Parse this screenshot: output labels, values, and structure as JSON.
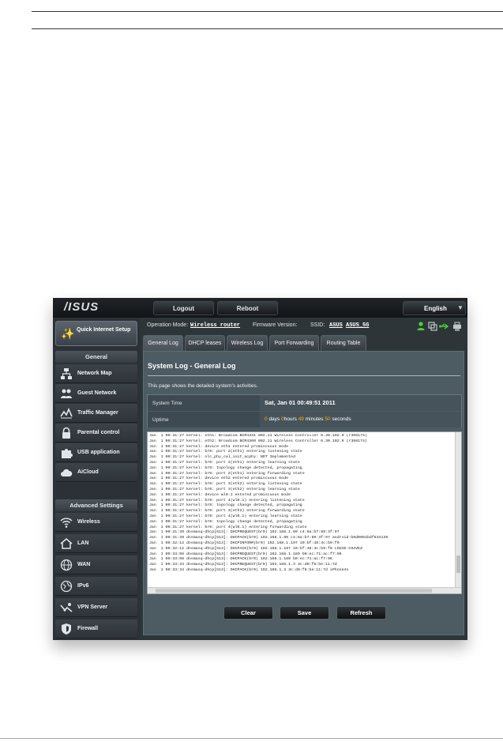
{
  "brand": {
    "logo_text": "/ISUS"
  },
  "topbar": {
    "logout_label": "Logout",
    "reboot_label": "Reboot",
    "language": "English"
  },
  "status": {
    "operation_mode_label": "Operation Mode:",
    "operation_mode_value": "Wireless router",
    "firmware_label": "Firmware Version:",
    "ssid_label": "SSID:",
    "ssid_1": "ASUS",
    "ssid_2": "ASUS_5G",
    "icons": [
      "user-icon",
      "copy-icon",
      "usb-icon",
      "printer-icon"
    ],
    "icon_color": "#4cd137"
  },
  "sidebar": {
    "quick_setup_label": "Quick Internet Setup",
    "general_header": "General",
    "general_items": [
      {
        "label": "Network Map",
        "icon": "network-map-icon"
      },
      {
        "label": "Guest Network",
        "icon": "guest-network-icon"
      },
      {
        "label": "Traffic Manager",
        "icon": "traffic-manager-icon"
      },
      {
        "label": "Parental control",
        "icon": "parental-control-icon"
      },
      {
        "label": "USB application",
        "icon": "usb-application-icon"
      },
      {
        "label": "AiCloud",
        "icon": "aicloud-icon"
      }
    ],
    "advanced_header": "Advanced Settings",
    "advanced_items": [
      {
        "label": "Wireless",
        "icon": "wireless-icon"
      },
      {
        "label": "LAN",
        "icon": "lan-icon"
      },
      {
        "label": "WAN",
        "icon": "wan-icon"
      },
      {
        "label": "IPv6",
        "icon": "ipv6-icon"
      },
      {
        "label": "VPN Server",
        "icon": "vpn-server-icon"
      },
      {
        "label": "Firewall",
        "icon": "firewall-icon"
      }
    ]
  },
  "tabs": [
    {
      "label": "General Log",
      "active": true
    },
    {
      "label": "DHCP leases",
      "active": false
    },
    {
      "label": "Wireless Log",
      "active": false
    },
    {
      "label": "Port Forwarding",
      "active": false
    },
    {
      "label": "Routing Table",
      "active": false
    }
  ],
  "panel": {
    "title": "System Log - General Log",
    "description": "This page shows the detailed system's activities.",
    "system_time_label": "System Time",
    "system_time_value": "Sat, Jan 01  00:49:51  2011",
    "uptime_label": "Uptime",
    "uptime": {
      "days": "0",
      "days_unit": "days",
      "hours": "0",
      "hours_unit": "hours",
      "minutes": "49",
      "minutes_unit": "minutes",
      "seconds": "50",
      "seconds_unit": "seconds"
    },
    "highlight_color": "#f5b400"
  },
  "log_lines": [
    "Jan  1 00:31:27 kernel: eth1: Broadcom BCM4331 802.11 Wireless Controller 6.30.102.9 (r366174)",
    "Jan  1 00:31:27 kernel: eth2: Broadcom BCM4360 802.11 Wireless Controller 6.30.102.9 (r366174)",
    "Jan  1 00:31:27 kernel: device eth1 entered promiscuous mode",
    "Jan  1 00:31:27 kernel: br0: port 2(eth1) entering listening state",
    "Jan  1 00:31:27 kernel: nlc_phy_cal_init_acphy: NOT Implemented",
    "Jan  1 00:31:27 kernel: br0: port 2(eth1) entering learning state",
    "Jan  1 00:31:27 kernel: br0: topology change detected, propagating",
    "Jan  1 00:31:27 kernel: br0: port 2(eth1) entering forwarding state",
    "Jan  1 00:31:27 kernel: device eth2 entered promiscuous mode",
    "Jan  1 00:31:27 kernel: br0: port 3(eth2) entering listening state",
    "Jan  1 00:31:27 kernel: br0: port 3(eth2) entering learning state",
    "Jan  1 00:31:27 kernel: device wl0.1 entered promiscuous mode",
    "Jan  1 00:31:27 kernel: br0: port 4(wl0.1) entering listening state",
    "Jan  1 00:31:27 kernel: br0: topology change detected, propagating",
    "Jan  1 00:31:27 kernel: br0: port 3(eth2) entering forwarding state",
    "Jan  1 00:31:27 kernel: br0: port 4(wl0.1) entering learning state",
    "Jan  1 00:31:27 kernel: br0: topology change detected, propagating",
    "Jan  1 00:31:27 kernel: br0: port 4(wl0.1) entering forwarding state",
    "Jan  1 00:31:39 dnsmasq-dhcp[513]: DHCPREQUEST(br0) 192.168.1.60 c4:6a:b7:89:3f:97",
    "Jan  1 00:31:39 dnsmasq-dhcp[513]: DHCPACK(br0) 192.168.1.60 c4:6a:b7:89:3f:97 android-b9d0081bdf634139",
    "Jan  1 00:32:12 dnsmasq-dhcp[513]: DHCPINFORM(br0) 192.168.1.197 10:bf:48:4c:b9:f0",
    "Jan  1 00:32:12 dnsmasq-dhcp[513]: DHCPACK(br0) 192.168.1.197 10:bf:48:4c:b9:f0 LOUIE-CHAVEZ",
    "Jan  1 00:33:08 dnsmasq-dhcp[513]: DHCPREQUEST(br0) 192.168.1.189 b0:ec:71:ac:f7:96",
    "Jan  1 00:33:08 dnsmasq-dhcp[513]: DHCPACK(br0) 192.168.1.189 b0:ec:71:ac:f7:96",
    "Jan  1 00:33:34 dnsmasq-dhcp[513]: DHCPREQUEST(br0) 192.168.1.3 3c:d0:f8:be:11:7d",
    "Jan  1 00:33:34 dnsmasq-dhcp[513]: DHCPACK(br0) 192.168.1.3 3c:d0:f8:be:11:7d iPhone4s"
  ],
  "actions": {
    "clear_label": "Clear",
    "save_label": "Save",
    "refresh_label": "Refresh"
  }
}
